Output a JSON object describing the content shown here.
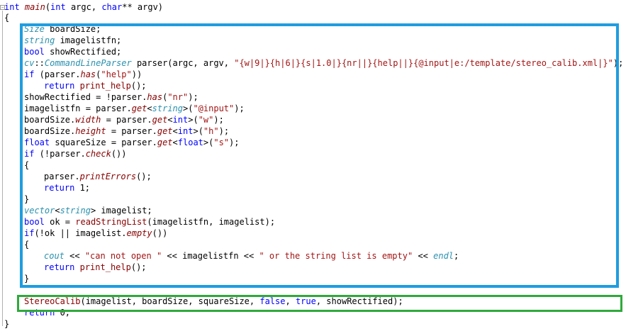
{
  "editor": {
    "lines": [
      {
        "indent": 0,
        "tokens": [
          {
            "t": "int ",
            "c": "kw"
          },
          {
            "t": "main",
            "c": "fn"
          },
          {
            "t": "(",
            "c": ""
          },
          {
            "t": "int",
            "c": "kw"
          },
          {
            "t": " argc, ",
            "c": ""
          },
          {
            "t": "char",
            "c": "kw"
          },
          {
            "t": "** argv)",
            "c": ""
          }
        ]
      },
      {
        "indent": 0,
        "tokens": [
          {
            "t": "{",
            "c": ""
          }
        ]
      },
      {
        "indent": 1,
        "tokens": [
          {
            "t": "Size",
            "c": "ty"
          },
          {
            "t": " boardSize;",
            "c": ""
          }
        ]
      },
      {
        "indent": 1,
        "tokens": [
          {
            "t": "string",
            "c": "ty"
          },
          {
            "t": " imagelistfn;",
            "c": ""
          }
        ]
      },
      {
        "indent": 1,
        "tokens": [
          {
            "t": "bool",
            "c": "kw"
          },
          {
            "t": " showRectified;",
            "c": ""
          }
        ]
      },
      {
        "indent": 1,
        "tokens": [
          {
            "t": "cv",
            "c": "ty"
          },
          {
            "t": "::",
            "c": ""
          },
          {
            "t": "CommandLineParser",
            "c": "ty"
          },
          {
            "t": " parser(argc, argv, ",
            "c": ""
          },
          {
            "t": "\"{w|9|}{h|6|}{s|1.0|}{nr||}{help||}{@input|e:/template/stereo_calib.xml|}\"",
            "c": "str"
          },
          {
            "t": ");",
            "c": ""
          }
        ]
      },
      {
        "indent": 1,
        "tokens": [
          {
            "t": "if",
            "c": "kw"
          },
          {
            "t": " (parser.",
            "c": ""
          },
          {
            "t": "has",
            "c": "fn"
          },
          {
            "t": "(",
            "c": ""
          },
          {
            "t": "\"help\"",
            "c": "str"
          },
          {
            "t": "))",
            "c": ""
          }
        ]
      },
      {
        "indent": 2,
        "tokens": [
          {
            "t": "return",
            "c": "kw"
          },
          {
            "t": " ",
            "c": ""
          },
          {
            "t": "print_help",
            "c": "fnp"
          },
          {
            "t": "();",
            "c": ""
          }
        ]
      },
      {
        "indent": 1,
        "tokens": [
          {
            "t": "showRectified = !parser.",
            "c": ""
          },
          {
            "t": "has",
            "c": "fn"
          },
          {
            "t": "(",
            "c": ""
          },
          {
            "t": "\"nr\"",
            "c": "str"
          },
          {
            "t": ");",
            "c": ""
          }
        ]
      },
      {
        "indent": 1,
        "tokens": [
          {
            "t": "imagelistfn = parser.",
            "c": ""
          },
          {
            "t": "get",
            "c": "fn"
          },
          {
            "t": "<",
            "c": ""
          },
          {
            "t": "string",
            "c": "ty"
          },
          {
            "t": ">(",
            "c": ""
          },
          {
            "t": "\"@input\"",
            "c": "str"
          },
          {
            "t": ");",
            "c": ""
          }
        ]
      },
      {
        "indent": 1,
        "tokens": [
          {
            "t": "boardSize.",
            "c": ""
          },
          {
            "t": "width",
            "c": "fn"
          },
          {
            "t": " = parser.",
            "c": ""
          },
          {
            "t": "get",
            "c": "fn"
          },
          {
            "t": "<",
            "c": ""
          },
          {
            "t": "int",
            "c": "kw"
          },
          {
            "t": ">(",
            "c": ""
          },
          {
            "t": "\"w\"",
            "c": "str"
          },
          {
            "t": ");",
            "c": ""
          }
        ]
      },
      {
        "indent": 1,
        "tokens": [
          {
            "t": "boardSize.",
            "c": ""
          },
          {
            "t": "height",
            "c": "fn"
          },
          {
            "t": " = parser.",
            "c": ""
          },
          {
            "t": "get",
            "c": "fn"
          },
          {
            "t": "<",
            "c": ""
          },
          {
            "t": "int",
            "c": "kw"
          },
          {
            "t": ">(",
            "c": ""
          },
          {
            "t": "\"h\"",
            "c": "str"
          },
          {
            "t": ");",
            "c": ""
          }
        ]
      },
      {
        "indent": 1,
        "tokens": [
          {
            "t": "float",
            "c": "kw"
          },
          {
            "t": " squareSize = parser.",
            "c": ""
          },
          {
            "t": "get",
            "c": "fn"
          },
          {
            "t": "<",
            "c": ""
          },
          {
            "t": "float",
            "c": "kw"
          },
          {
            "t": ">(",
            "c": ""
          },
          {
            "t": "\"s\"",
            "c": "str"
          },
          {
            "t": ");",
            "c": ""
          }
        ]
      },
      {
        "indent": 1,
        "tokens": [
          {
            "t": "if",
            "c": "kw"
          },
          {
            "t": " (!parser.",
            "c": ""
          },
          {
            "t": "check",
            "c": "fn"
          },
          {
            "t": "())",
            "c": ""
          }
        ]
      },
      {
        "indent": 1,
        "tokens": [
          {
            "t": "{",
            "c": ""
          }
        ]
      },
      {
        "indent": 2,
        "tokens": [
          {
            "t": "parser.",
            "c": ""
          },
          {
            "t": "printErrors",
            "c": "fn"
          },
          {
            "t": "();",
            "c": ""
          }
        ]
      },
      {
        "indent": 2,
        "tokens": [
          {
            "t": "return",
            "c": "kw"
          },
          {
            "t": " 1;",
            "c": ""
          }
        ]
      },
      {
        "indent": 1,
        "tokens": [
          {
            "t": "}",
            "c": ""
          }
        ]
      },
      {
        "indent": 1,
        "tokens": [
          {
            "t": "vector",
            "c": "ty"
          },
          {
            "t": "<",
            "c": ""
          },
          {
            "t": "string",
            "c": "ty"
          },
          {
            "t": "> imagelist;",
            "c": ""
          }
        ]
      },
      {
        "indent": 1,
        "tokens": [
          {
            "t": "bool",
            "c": "kw"
          },
          {
            "t": " ok = ",
            "c": ""
          },
          {
            "t": "readStringList",
            "c": "fnp"
          },
          {
            "t": "(imagelistfn, imagelist);",
            "c": ""
          }
        ]
      },
      {
        "indent": 1,
        "tokens": [
          {
            "t": "if",
            "c": "kw"
          },
          {
            "t": "(!ok || imagelist.",
            "c": ""
          },
          {
            "t": "empty",
            "c": "fn"
          },
          {
            "t": "())",
            "c": ""
          }
        ]
      },
      {
        "indent": 1,
        "tokens": [
          {
            "t": "{",
            "c": ""
          }
        ]
      },
      {
        "indent": 2,
        "tokens": [
          {
            "t": "cout",
            "c": "ty"
          },
          {
            "t": " << ",
            "c": ""
          },
          {
            "t": "\"can not open \"",
            "c": "str"
          },
          {
            "t": " << imagelistfn << ",
            "c": ""
          },
          {
            "t": "\" or the string list is empty\"",
            "c": "str"
          },
          {
            "t": " << ",
            "c": ""
          },
          {
            "t": "endl",
            "c": "ty"
          },
          {
            "t": ";",
            "c": ""
          }
        ]
      },
      {
        "indent": 2,
        "tokens": [
          {
            "t": "return",
            "c": "kw"
          },
          {
            "t": " ",
            "c": ""
          },
          {
            "t": "print_help",
            "c": "fnp"
          },
          {
            "t": "();",
            "c": ""
          }
        ]
      },
      {
        "indent": 1,
        "tokens": [
          {
            "t": "}",
            "c": ""
          }
        ]
      },
      {
        "indent": 0,
        "tokens": []
      },
      {
        "indent": 1,
        "tokens": [
          {
            "t": "StereoCalib",
            "c": "fnp"
          },
          {
            "t": "(imagelist, boardSize, squareSize, ",
            "c": ""
          },
          {
            "t": "false",
            "c": "kw"
          },
          {
            "t": ", ",
            "c": ""
          },
          {
            "t": "true",
            "c": "kw"
          },
          {
            "t": ", showRectified);",
            "c": ""
          }
        ]
      },
      {
        "indent": 1,
        "tokens": [
          {
            "t": "return",
            "c": "kw"
          },
          {
            "t": " 0;",
            "c": ""
          }
        ]
      },
      {
        "indent": 0,
        "tokens": [
          {
            "t": "}",
            "c": ""
          }
        ]
      }
    ]
  },
  "highlights": {
    "blue_color": "#1f9de0",
    "green_color": "#2eaa3a"
  },
  "icons": {
    "fold": "fold-collapse-icon"
  }
}
